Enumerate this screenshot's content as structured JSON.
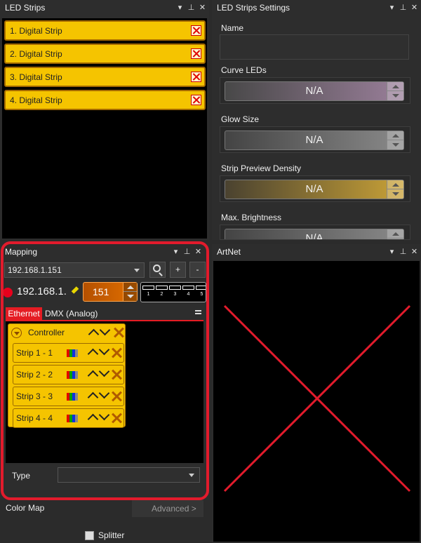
{
  "led_strips": {
    "title": "LED Strips",
    "items": [
      {
        "label": "1. Digital Strip"
      },
      {
        "label": "2. Digital Strip"
      },
      {
        "label": "3. Digital Strip"
      },
      {
        "label": "4. Digital Strip"
      }
    ]
  },
  "settings": {
    "title": "LED Strips Settings",
    "name_label": "Name",
    "name_value": "",
    "fields": [
      {
        "label": "Curve LEDs",
        "value": "N/A",
        "color": "#9a7f9a"
      },
      {
        "label": "Glow Size",
        "value": "N/A",
        "color": "#8a8a8a"
      },
      {
        "label": "Strip Preview Density",
        "value": "N/A",
        "color": "#c9a237"
      },
      {
        "label": "Max. Brightness",
        "value": "N/A",
        "color": "#8a8a8a"
      }
    ]
  },
  "mapping": {
    "title": "Mapping",
    "ip_select": "192.168.1.151",
    "add_label": "+",
    "remove_label": "-",
    "ip_display": "192.168.1.",
    "universe_value": "151",
    "ports": [
      "1",
      "2",
      "3",
      "4",
      "5"
    ],
    "tabs": {
      "ethernet": "Ethernet",
      "dmx": "DMX (Analog)"
    },
    "controller": {
      "label": "Controller",
      "strips": [
        {
          "label": "Strip 1 - 1"
        },
        {
          "label": "Strip 2 - 2"
        },
        {
          "label": "Strip 3 - 3"
        },
        {
          "label": "Strip 4 - 4"
        }
      ],
      "strip_colors": [
        "#e00000",
        "#00a000",
        "#1030e0",
        "#888888"
      ]
    },
    "type_label": "Type",
    "type_value": ""
  },
  "color_map": {
    "title": "Color Map",
    "advanced_label": "Advanced >",
    "splitter_label": "Splitter"
  },
  "artnet": {
    "title": "ArtNet"
  },
  "title_buttons": {
    "menu": "▾",
    "pin": "⊥",
    "close": "✕"
  }
}
